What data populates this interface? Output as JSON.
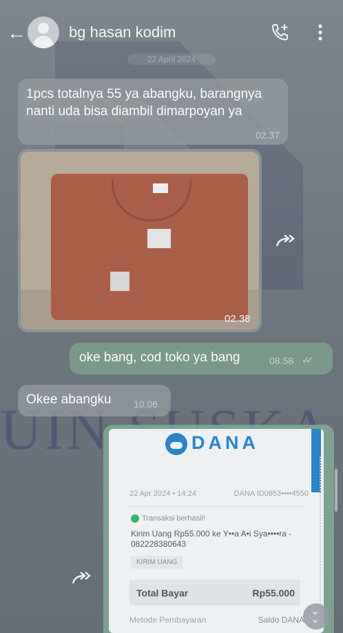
{
  "header": {
    "back_icon": "arrow-left-icon",
    "contact_name": "bg hasan kodim",
    "call_icon": "add-call-icon",
    "menu_icon": "more-vert-icon"
  },
  "date_divider": "22 April 2024",
  "messages": [
    {
      "type": "incoming",
      "text": "1pcs totalnya 55 ya abangku, barangnya nanti uda bisa diambil dimarpoyan ya",
      "time": "02.37"
    },
    {
      "type": "incoming-image",
      "time": "02.38"
    },
    {
      "type": "outgoing",
      "text": "oke bang, cod toko ya bang",
      "time": "08.58",
      "status": "read"
    },
    {
      "type": "incoming",
      "text": "Okee abangku",
      "time": "10.06"
    }
  ],
  "receipt": {
    "brand": "DANA",
    "datetime": "22 Apr 2024 • 14:24",
    "dana_id": "DANA ID0853••••4550",
    "status": "Transaksi berhasil!",
    "description": "Kirim Uang Rp55.000 ke Y••a A•i Sya••••ra - 082228380643",
    "tag": "KIRIM UANG",
    "total_label": "Total Bayar",
    "total_value": "Rp55.000",
    "method_label": "Metode Pembayaran",
    "method_value": "Saldo DANA"
  },
  "watermark": {
    "text": "UIN SUSKA"
  },
  "colors": {
    "dana_blue": "#2b83c8",
    "outgoing_bubble": "#7ea08e",
    "incoming_bubble": "#969ca2"
  }
}
